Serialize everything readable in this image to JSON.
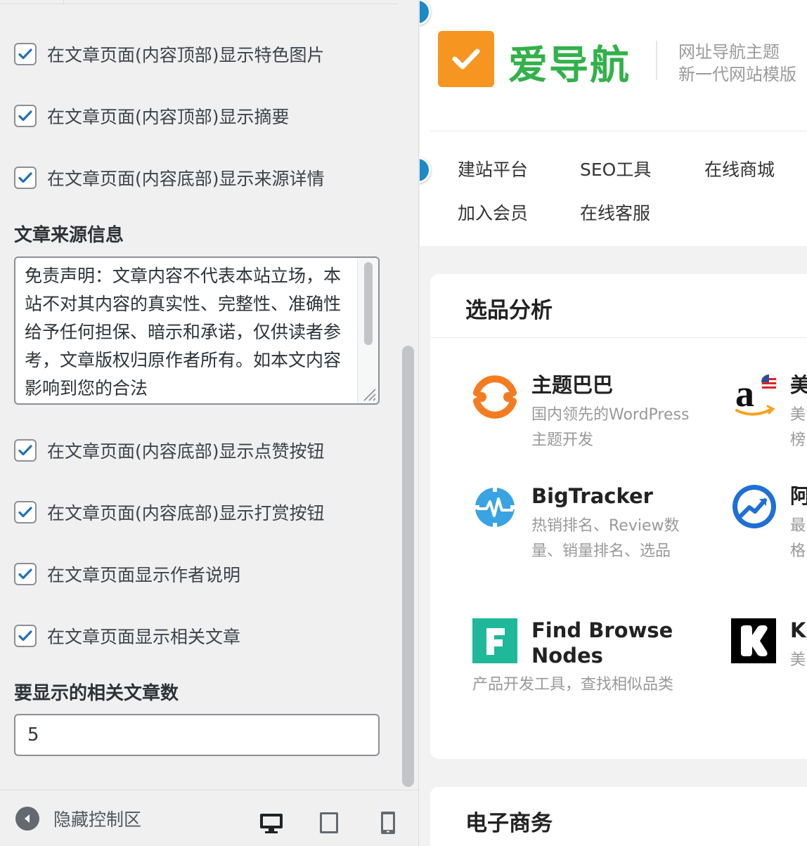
{
  "customizer": {
    "checkboxes": [
      {
        "label": "在文章页面(内容顶部)显示特色图片",
        "checked": true
      },
      {
        "label": "在文章页面(内容顶部)显示摘要",
        "checked": true
      },
      {
        "label": "在文章页面(内容底部)显示来源详情",
        "checked": true
      },
      {
        "label": "在文章页面(内容底部)显示点赞按钮",
        "checked": true
      },
      {
        "label": "在文章页面(内容底部)显示打赏按钮",
        "checked": true
      },
      {
        "label": "在文章页面显示作者说明",
        "checked": true
      },
      {
        "label": "在文章页面显示相关文章",
        "checked": true
      }
    ],
    "source_info": {
      "title": "文章来源信息",
      "value": "免责声明：文章内容不代表本站立场，本站不对其内容的真实性、完整性、准确性给予任何担保、暗示和承诺，仅供读者参考，文章版权归原作者所有。如本文内容影响到您的合法"
    },
    "related_count": {
      "title": "要显示的相关文章数",
      "value": "5"
    },
    "footer": {
      "collapse_label": "隐藏控制区"
    }
  },
  "preview": {
    "logo": {
      "text": "爱导航",
      "color": "#32b14a",
      "box_color": "#f69621"
    },
    "slogan": [
      "网址导航主题",
      "新一代网站模版"
    ],
    "nav": [
      "建站平台",
      "SEO工具",
      "在线商城",
      "加入会员",
      "在线客服"
    ],
    "sections": [
      {
        "title": "选品分析",
        "sites": [
          {
            "name": "主题巴巴",
            "desc": "国内领先的WordPress主题开发",
            "icon": "theme88-icon"
          },
          {
            "name": "美",
            "desc": "美榜",
            "icon": "amazon-us-icon"
          },
          {
            "name": "BigTracker",
            "desc": "热销排名、Review数量、销量排名、选品",
            "icon": "bigtracker-icon"
          },
          {
            "name": "阿",
            "desc": "最格",
            "icon": "trend-chart-icon"
          },
          {
            "name": "Find Browse Nodes",
            "desc": "产品开发工具，查找相似品类",
            "icon": "find-browse-nodes-icon"
          },
          {
            "name": "Ki",
            "desc": "美",
            "icon": "ki-icon"
          }
        ]
      },
      {
        "title": "电子商务"
      }
    ]
  },
  "colors": {
    "accent": "#2271b1",
    "edit_dot": "#1d8ac6"
  }
}
